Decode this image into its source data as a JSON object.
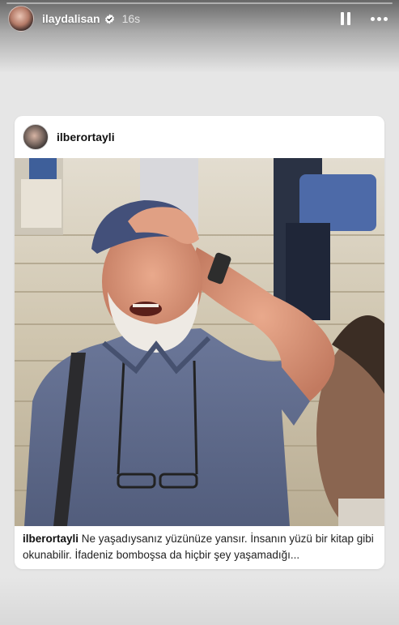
{
  "story": {
    "username": "ilaydalisan",
    "timestamp": "16s",
    "progress": 0,
    "icons": {
      "verified": "verified-badge-icon",
      "pause": "pause-icon",
      "more": "more-options-icon"
    }
  },
  "post": {
    "username": "ilberortayli",
    "caption_user": "ilberortayli",
    "caption_text": " Ne yaşadıysanız yüzünüze yansır. İnsanın yüzü bir kitap gibi okunabilir. İfadeniz bomboşsa da hiçbir şey yaşamadığı..."
  },
  "colors": {
    "card_bg": "#ffffff",
    "story_bg": "#e6e6e6",
    "shirt": "#5d6a8c",
    "cap": "#3f4b6b"
  }
}
